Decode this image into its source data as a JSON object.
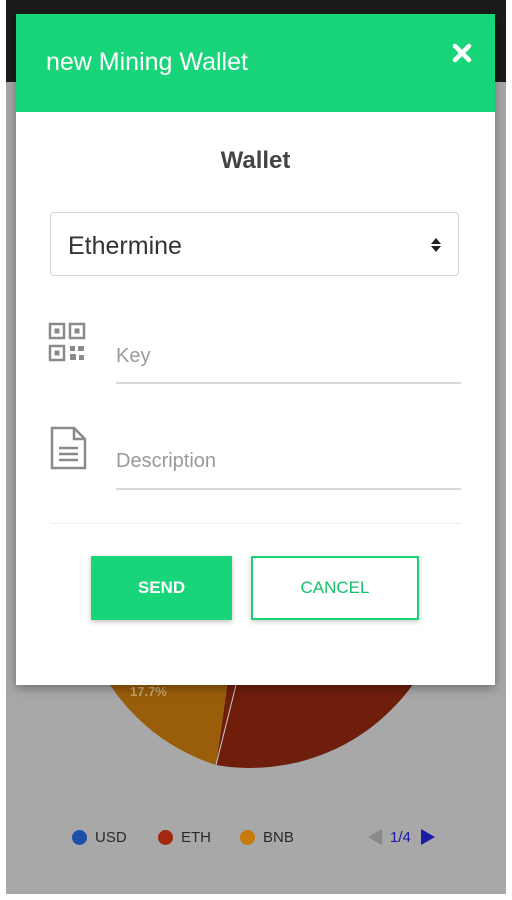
{
  "modal": {
    "title": "new Mining Wallet",
    "section_title": "Wallet",
    "pool_select": {
      "value": "Ethermine"
    },
    "key_field": {
      "placeholder": "Key",
      "value": ""
    },
    "description_field": {
      "placeholder": "Description",
      "value": ""
    },
    "send_label": "SEND",
    "cancel_label": "CANCEL"
  },
  "background": {
    "pie_label": "17.7%",
    "legend": [
      {
        "label": "USD",
        "color": "#1e4fa8"
      },
      {
        "label": "ETH",
        "color": "#a12a0e"
      },
      {
        "label": "BNB",
        "color": "#c77a08"
      }
    ],
    "pager": {
      "text": "1/4"
    }
  },
  "colors": {
    "accent": "#18d57a",
    "header_text": "#ffffff"
  }
}
